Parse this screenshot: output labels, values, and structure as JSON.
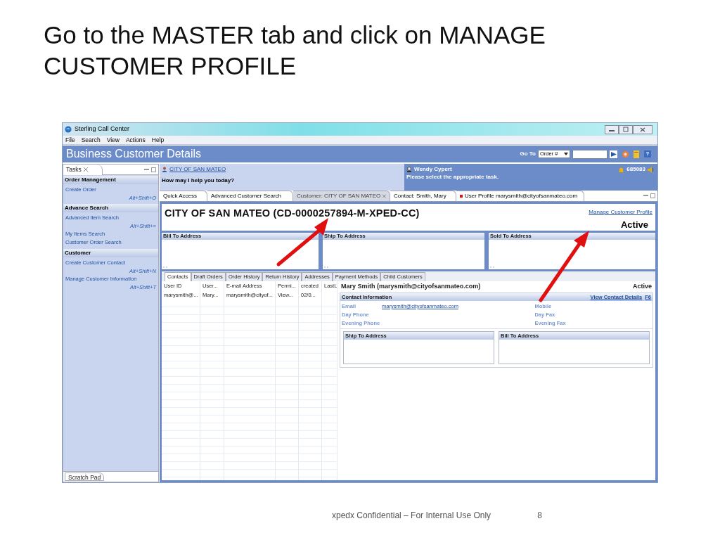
{
  "slide": {
    "title": "Go to the MASTER tab and click on MANAGE CUSTOMER PROFILE",
    "footer": "xpedx Confidential – For Internal Use Only",
    "page_number": "8"
  },
  "window": {
    "title": "Sterling Call Center"
  },
  "menu": [
    "File",
    "Search",
    "View",
    "Actions",
    "Help"
  ],
  "header": {
    "title": "Business Customer Details",
    "goto_label": "Go To",
    "goto_type": "Order #",
    "help_button": "?"
  },
  "sidebar": {
    "tab": "Tasks",
    "sections": [
      {
        "title": "Order Management",
        "items": [
          {
            "label": "Create Order",
            "shortcut": "Alt+Shift+O"
          }
        ]
      },
      {
        "title": "Advance Search",
        "items": [
          {
            "label": "Advanced Item Search",
            "shortcut": "Alt+Shift+="
          },
          {
            "label": "My Items Search"
          },
          {
            "label": "Customer Order Search"
          }
        ]
      },
      {
        "title": "Customer",
        "items": [
          {
            "label": "Create Customer Contact",
            "shortcut": "Alt+Shift+N"
          },
          {
            "label": "Manage Customer Information",
            "shortcut": "Alt+Shift+T"
          }
        ]
      }
    ],
    "bottom_tab": "Scratch Pad"
  },
  "info_bar": {
    "customer": "CITY OF SAN MATEO",
    "prompt": "How may I help you today?",
    "agent": "Wendy Cypert",
    "message": "Please select the appropriate task.",
    "count": "685083"
  },
  "tabs": [
    {
      "label": "Quick Access",
      "selected": false,
      "closable": false,
      "flag": false
    },
    {
      "label": "Advanced Customer Search",
      "selected": false,
      "closable": false,
      "flag": false
    },
    {
      "label": "Customer: CITY OF SAN MATEO",
      "selected": true,
      "closable": true,
      "flag": false
    },
    {
      "label": "Contact: Smith, Mary",
      "selected": false,
      "closable": false,
      "flag": false
    },
    {
      "label": "User Profile marysmith@cityofsanmateo.com",
      "selected": false,
      "closable": false,
      "flag": true
    }
  ],
  "customer": {
    "title": "CITY OF SAN MATEO (CD-0000257894-M-XPED-CC)",
    "link": "Manage Customer Profile",
    "status": "Active",
    "addresses": [
      {
        "title": "Bill To Address",
        "value": ", ,"
      },
      {
        "title": "Ship To Address",
        "value": ", ,"
      },
      {
        "title": "Sold To Address",
        "value": ", ,"
      }
    ]
  },
  "subtabs": [
    {
      "label": "Contacts",
      "selected": true
    },
    {
      "label": "Draft Orders",
      "selected": false
    },
    {
      "label": "Order History",
      "selected": false
    },
    {
      "label": "Return History",
      "selected": false
    },
    {
      "label": "Addresses",
      "selected": false
    },
    {
      "label": "Payment Methods",
      "selected": false
    },
    {
      "label": "Child Customers",
      "selected": false
    }
  ],
  "contacts_table": {
    "columns": [
      "User ID",
      "User...",
      "E-mail Address",
      "Permi...",
      "created",
      "LastL"
    ],
    "rows": [
      [
        "marysmith@...",
        "Mary...",
        "marysmith@cityof...",
        "View...",
        "02/0..."
      ]
    ]
  },
  "contact": {
    "name": "Mary Smith (marysmith@cityofsanmateo.com)",
    "status": "Active",
    "section_title": "Contact Information",
    "details_link": "View Contact Details",
    "details_key": "F6",
    "fields": [
      {
        "label": "Email",
        "value": "marysmith@cityofsanmateo.com"
      },
      {
        "label": "Day Phone"
      },
      {
        "label": "Evening Phone"
      },
      {
        "label": "Mobile"
      },
      {
        "label": "Day Fax"
      },
      {
        "label": "Evening Fax"
      }
    ],
    "addresses": [
      {
        "title": "Ship To Address"
      },
      {
        "title": "Bill To Address"
      }
    ]
  }
}
